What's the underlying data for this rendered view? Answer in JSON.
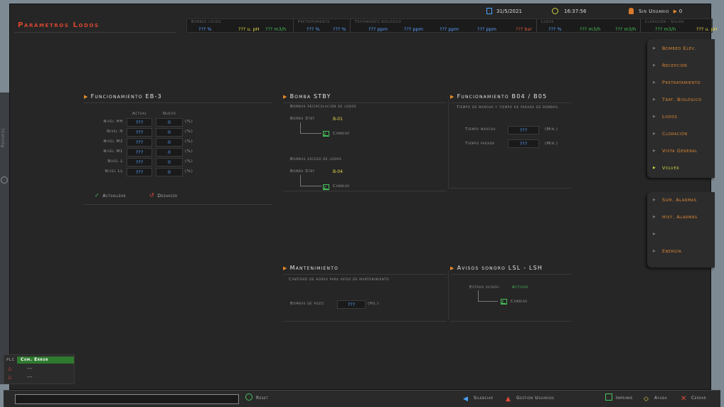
{
  "header": {
    "title": "Parámetros Lodos",
    "date": "31/5/2021",
    "time": "16:37:56",
    "user": "Sin Usuario",
    "user_level": "0"
  },
  "procbar": {
    "segments": [
      {
        "label": "Bombeo crudo",
        "values": [
          {
            "text": "??? %",
            "color": "blue"
          },
          {
            "text": "??? u. pH",
            "color": "yellow"
          },
          {
            "text": "??? m3/h",
            "color": "green"
          }
        ]
      },
      {
        "label": "Pretratamiento",
        "values": [
          {
            "text": "??? %",
            "color": "blue"
          },
          {
            "text": "??? %",
            "color": "blue"
          }
        ]
      },
      {
        "label": "Tratamiento biológico",
        "values": [
          {
            "text": "??? ppm",
            "color": "blue"
          },
          {
            "text": "??? ppm",
            "color": "blue"
          },
          {
            "text": "??? ppm",
            "color": "blue"
          },
          {
            "text": "??? ppm",
            "color": "blue"
          },
          {
            "text": "??? bar",
            "color": "red"
          }
        ]
      },
      {
        "label": "Lodos",
        "values": [
          {
            "text": "??? %",
            "color": "blue"
          },
          {
            "text": "??? m3/h",
            "color": "green"
          },
          {
            "text": "??? m3/h",
            "color": "green"
          }
        ]
      },
      {
        "label": "Cloración - Salida",
        "values": [
          {
            "text": "??? m3/h",
            "color": "green"
          },
          {
            "text": "??? u. pH",
            "color": "yellow"
          }
        ]
      }
    ]
  },
  "nav_main": [
    {
      "label": "Bombeo Elev.",
      "selected": false
    },
    {
      "label": "Recepción",
      "selected": false
    },
    {
      "label": "Pretratamiento",
      "selected": false
    },
    {
      "label": "Trat. Biológico",
      "selected": false
    },
    {
      "label": "Lodos",
      "selected": false
    },
    {
      "label": "Cloración",
      "selected": false
    },
    {
      "label": "Vista General",
      "selected": false
    },
    {
      "label": "Volver",
      "selected": true
    }
  ],
  "nav_secondary": [
    {
      "label": "Sum. Alarmas"
    },
    {
      "label": "Hist. Alarmas"
    },
    {
      "label": ""
    },
    {
      "label": "Energía"
    }
  ],
  "eb3": {
    "title": "Funcionamiento EB-3",
    "col_actual": "Actual",
    "col_nuevo": "Nuevo",
    "unit": "(%)",
    "rows": [
      {
        "label": "Nivel HH",
        "actual": "???",
        "nuevo": "0"
      },
      {
        "label": "Nivel H",
        "actual": "???",
        "nuevo": "0"
      },
      {
        "label": "Nivel M2",
        "actual": "???",
        "nuevo": "0"
      },
      {
        "label": "Nivel M1",
        "actual": "???",
        "nuevo": "0"
      },
      {
        "label": "Nivel L",
        "actual": "???",
        "nuevo": "0"
      },
      {
        "label": "Nivel LL",
        "actual": "???",
        "nuevo": "0"
      }
    ],
    "actualizar": "Actualizar",
    "deshacer": "Deshacer"
  },
  "stby": {
    "title": "Bomba STBY",
    "group1_label": "Bombas recirculación de lodos",
    "group1_stby_label": "Bomba Stby",
    "group1_value": "B-01",
    "group2_label": "Bombas exceso de lodos",
    "group2_stby_label": "Bomba Stby",
    "group2_value": "B-04",
    "cambiar": "Cambiar"
  },
  "b04": {
    "title": "Funcionamiento B04 / B05",
    "desc": "Tiempo de marcha y tiempo de parada de bombas.",
    "marcha_label": "Tiempo marcha",
    "marcha_value": "???",
    "parada_label": "Tiempo parada",
    "parada_value": "???",
    "unit": "(Min.)"
  },
  "mant": {
    "title": "Mantenimiento",
    "desc": "Cantidad de horas para aviso de mantenimiento",
    "pozo_label": "Bombas de pozo",
    "pozo_value": "???",
    "unit": "(Hs.)"
  },
  "avisos": {
    "title": "Avisos sonoro LSL - LSH",
    "estado_label": "Estado avisos:",
    "estado_value": "Activos",
    "cambiar": "Cambiar"
  },
  "plc": {
    "label": "PLC",
    "status": "Com. Error",
    "warn1": "---",
    "warn2": "---"
  },
  "bottom": {
    "reset": "Reset",
    "silenciar": "Silenciar",
    "gestion": "Gestión Usuarios",
    "imprimir": "Imprimir",
    "ayuda": "Ayuda",
    "cerrar": "Cerrar"
  },
  "side_label": "Reportes",
  "colors": {
    "accent": "#e4892a",
    "title_red": "#d9472f",
    "value_blue": "#5aa0ff",
    "ok_green": "#46c25a",
    "stby_yellow": "#e9d84a",
    "plc_green": "#2f7a2f"
  }
}
